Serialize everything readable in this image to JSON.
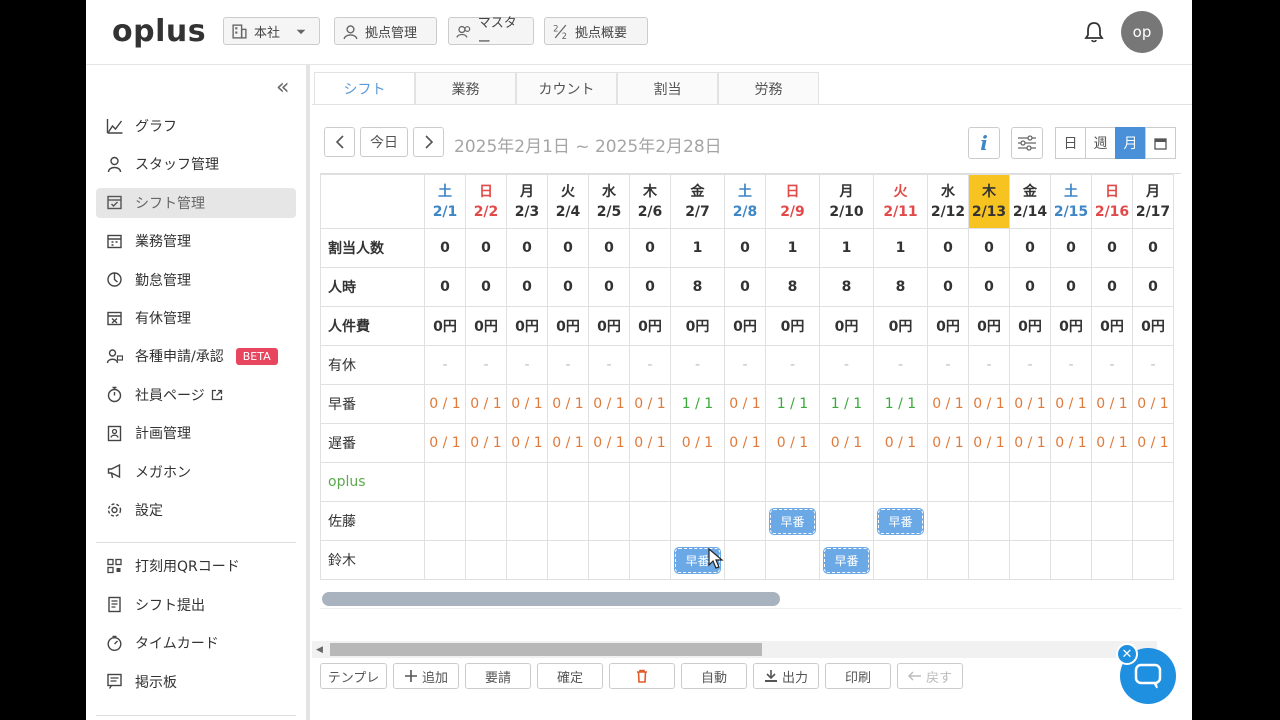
{
  "app": {
    "logo": "oplus"
  },
  "header": {
    "buttons": [
      {
        "label": "本社",
        "icon": "building-icon"
      },
      {
        "label": "拠点管理",
        "icon": "location-user-icon"
      },
      {
        "label": "マスター",
        "icon": "users-icon"
      },
      {
        "label": "拠点概要",
        "icon": "fraction-icon"
      }
    ],
    "avatar": "op"
  },
  "sidebar": {
    "items": [
      {
        "label": "グラフ",
        "icon": "chart-icon"
      },
      {
        "label": "スタッフ管理",
        "icon": "user-icon"
      },
      {
        "label": "シフト管理",
        "icon": "calendar-check-icon",
        "active": true
      },
      {
        "label": "業務管理",
        "icon": "calendar-icon"
      },
      {
        "label": "勤怠管理",
        "icon": "clock-icon"
      },
      {
        "label": "有休管理",
        "icon": "calendar-x-icon"
      },
      {
        "label": "各種申請/承認",
        "icon": "user-request-icon",
        "badge": "BETA"
      },
      {
        "label": "社員ページ",
        "icon": "stopwatch-icon",
        "external": true
      },
      {
        "label": "計画管理",
        "icon": "plan-icon"
      },
      {
        "label": "メガホン",
        "icon": "megaphone-icon"
      },
      {
        "label": "設定",
        "icon": "gear-icon"
      }
    ],
    "items2": [
      {
        "label": "打刻用QRコード",
        "icon": "qr-icon"
      },
      {
        "label": "シフト提出",
        "icon": "document-icon"
      },
      {
        "label": "タイムカード",
        "icon": "timer-icon"
      },
      {
        "label": "掲示板",
        "icon": "board-icon"
      }
    ]
  },
  "tabs": [
    "シフト",
    "業務",
    "カウント",
    "割当",
    "労務"
  ],
  "toolbar": {
    "today": "今日",
    "range": "2025年2月1日 ~ 2025年2月28日",
    "views": [
      "日",
      "週",
      "月"
    ]
  },
  "grid": {
    "days": [
      {
        "dow": "土",
        "date": "2/1",
        "type": "sat"
      },
      {
        "dow": "日",
        "date": "2/2",
        "type": "sun"
      },
      {
        "dow": "月",
        "date": "2/3",
        "type": ""
      },
      {
        "dow": "火",
        "date": "2/4",
        "type": ""
      },
      {
        "dow": "水",
        "date": "2/5",
        "type": ""
      },
      {
        "dow": "木",
        "date": "2/6",
        "type": ""
      },
      {
        "dow": "金",
        "date": "2/7",
        "type": ""
      },
      {
        "dow": "土",
        "date": "2/8",
        "type": "sat"
      },
      {
        "dow": "日",
        "date": "2/9",
        "type": "sun"
      },
      {
        "dow": "月",
        "date": "2/10",
        "type": ""
      },
      {
        "dow": "火",
        "date": "2/11",
        "type": "sun"
      },
      {
        "dow": "水",
        "date": "2/12",
        "type": ""
      },
      {
        "dow": "木",
        "date": "2/13",
        "type": "today"
      },
      {
        "dow": "金",
        "date": "2/14",
        "type": ""
      },
      {
        "dow": "土",
        "date": "2/15",
        "type": "sat"
      },
      {
        "dow": "日",
        "date": "2/16",
        "type": "sun"
      },
      {
        "dow": "月",
        "date": "2/17",
        "type": ""
      }
    ],
    "rows": {
      "assigned": {
        "label": "割当人数",
        "values": [
          "0",
          "0",
          "0",
          "0",
          "0",
          "0",
          "1",
          "0",
          "1",
          "1",
          "1",
          "0",
          "0",
          "0",
          "0",
          "0",
          "0"
        ]
      },
      "hours": {
        "label": "人時",
        "values": [
          "0",
          "0",
          "0",
          "0",
          "0",
          "0",
          "8",
          "0",
          "8",
          "8",
          "8",
          "0",
          "0",
          "0",
          "0",
          "0",
          "0"
        ]
      },
      "cost": {
        "label": "人件費",
        "values": [
          "0円",
          "0円",
          "0円",
          "0円",
          "0円",
          "0円",
          "0円",
          "0円",
          "0円",
          "0円",
          "0円",
          "0円",
          "0円",
          "0円",
          "0円",
          "0円",
          "0円"
        ]
      },
      "paid_leave": {
        "label": "有休",
        "values": [
          "-",
          "-",
          "-",
          "-",
          "-",
          "-",
          "-",
          "-",
          "-",
          "-",
          "-",
          "-",
          "-",
          "-",
          "-",
          "-",
          "-"
        ]
      },
      "early": {
        "label": "早番",
        "values": [
          "0 / 1",
          "0 / 1",
          "0 / 1",
          "0 / 1",
          "0 / 1",
          "0 / 1",
          "1 / 1",
          "0 / 1",
          "1 / 1",
          "1 / 1",
          "1 / 1",
          "0 / 1",
          "0 / 1",
          "0 / 1",
          "0 / 1",
          "0 / 1",
          "0 / 1"
        ]
      },
      "late": {
        "label": "遅番",
        "values": [
          "0 / 1",
          "0 / 1",
          "0 / 1",
          "0 / 1",
          "0 / 1",
          "0 / 1",
          "0 / 1",
          "0 / 1",
          "0 / 1",
          "0 / 1",
          "0 / 1",
          "0 / 1",
          "0 / 1",
          "0 / 1",
          "0 / 1",
          "0 / 1",
          "0 / 1"
        ]
      }
    },
    "group": "oplus",
    "staff": [
      {
        "name": "佐藤",
        "shifts": {
          "8": "早番",
          "10": "早番"
        }
      },
      {
        "name": "鈴木",
        "shifts": {
          "6": "早番",
          "9": "早番"
        }
      }
    ]
  },
  "bottom": [
    "テンプレ",
    "追加",
    "要請",
    "確定",
    "",
    "自動",
    "出力",
    "印刷",
    "戻す"
  ],
  "colors": {
    "accent": "#4a90d9",
    "saturday": "#3e86c6",
    "sunday": "#e24a4a",
    "today": "#f7c321",
    "chip": "#6aa8e6",
    "beta": "#e8455f"
  }
}
